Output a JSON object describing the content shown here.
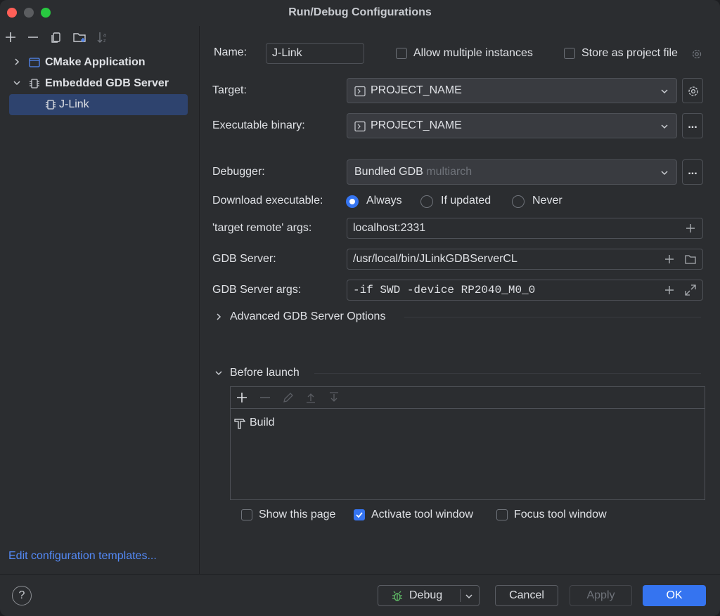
{
  "window": {
    "title": "Run/Debug Configurations"
  },
  "sidebar": {
    "toolbar_icons": [
      "add-icon",
      "remove-icon",
      "copy-icon",
      "new-folder-icon",
      "sort-icon"
    ],
    "tree": [
      {
        "label": "CMake Application",
        "icon": "cmake-app-icon",
        "expanded": false
      },
      {
        "label": "Embedded GDB Server",
        "icon": "chip-icon",
        "expanded": true
      },
      {
        "label": "J-Link",
        "icon": "chip-icon",
        "selected": true
      }
    ],
    "edit_templates_link": "Edit configuration templates..."
  },
  "form": {
    "name_label": "Name:",
    "name_value": "J-Link",
    "allow_multiple_label": "Allow multiple instances",
    "store_project_label": "Store as project file",
    "target_label": "Target:",
    "target_value": "PROJECT_NAME",
    "exec_label": "Executable binary:",
    "exec_value": "PROJECT_NAME",
    "debugger_label": "Debugger:",
    "debugger_value": "Bundled GDB",
    "debugger_suffix": "multiarch",
    "download_label": "Download executable:",
    "download_options": [
      "Always",
      "If updated",
      "Never"
    ],
    "download_selected": "Always",
    "target_remote_label": "'target remote' args:",
    "target_remote_value": "localhost:2331",
    "gdb_server_label": "GDB Server:",
    "gdb_server_value": "/usr/local/bin/JLinkGDBServerCL",
    "gdb_server_args_label": "GDB Server args:",
    "gdb_server_args_value": "-if SWD -device RP2040_M0_0",
    "advanced_label": "Advanced GDB Server Options",
    "before_launch_label": "Before launch",
    "before_launch_items": [
      {
        "label": "Build",
        "icon": "build-hammer-icon"
      }
    ],
    "show_page_label": "Show this page",
    "activate_tool_label": "Activate tool window",
    "focus_tool_label": "Focus tool window",
    "show_page_checked": false,
    "activate_tool_checked": true,
    "focus_tool_checked": false
  },
  "footer": {
    "help_label": "?",
    "debug_label": "Debug",
    "cancel_label": "Cancel",
    "apply_label": "Apply",
    "ok_label": "OK"
  },
  "colors": {
    "accent": "#3574f0",
    "link": "#548af7",
    "selection": "#2e436e",
    "background": "#2b2d30"
  }
}
